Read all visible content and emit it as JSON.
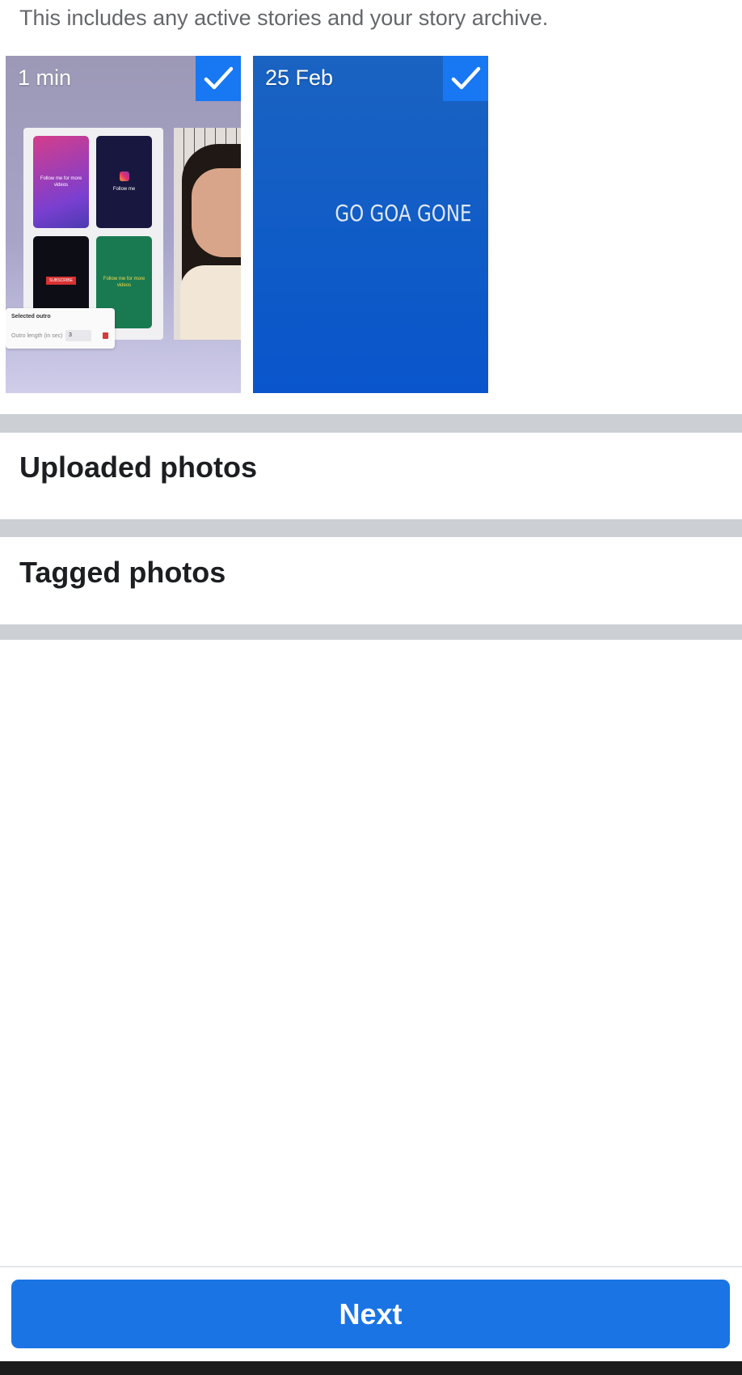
{
  "header": {
    "subtitle": "This includes any active stories and your story archive."
  },
  "stories": [
    {
      "date": "1 min",
      "selected": true,
      "preview": {
        "cards": [
          "Follow me for more videos",
          "Follow me",
          "SUBSCRIBE",
          "Follow me for more videos"
        ],
        "panel_title": "Selected outro",
        "field_label": "Outro length (in sec)",
        "field_value": "3"
      }
    },
    {
      "date": "25 Feb",
      "selected": true,
      "preview": {
        "text": "GO GOA GONE"
      }
    }
  ],
  "sections": {
    "uploaded": "Uploaded photos",
    "tagged": "Tagged photos"
  },
  "footer": {
    "next_label": "Next"
  },
  "colors": {
    "accent": "#1b74e4",
    "divider": "#ccd0d5",
    "story2_bg": "#0f5bc7"
  },
  "icons": {
    "checkmark": "check-icon"
  }
}
